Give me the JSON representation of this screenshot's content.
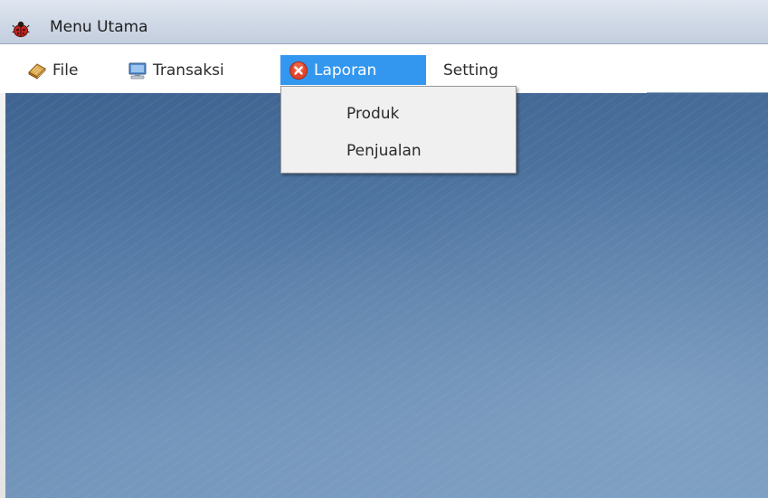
{
  "window": {
    "title": "Menu Utama",
    "icon": "ladybug-icon"
  },
  "menubar": {
    "items": [
      {
        "label": "File",
        "icon": "book-icon"
      },
      {
        "label": "Transaksi",
        "icon": "computer-icon"
      },
      {
        "label": "Laporan",
        "icon": "error-x-icon",
        "state": "open"
      },
      {
        "label": "Setting"
      }
    ]
  },
  "dropdown": {
    "items": [
      {
        "label": "Produk"
      },
      {
        "label": "Penjualan"
      }
    ]
  },
  "colors": {
    "menu_highlight": "#3397f0",
    "desktop": "#4e74a0"
  }
}
